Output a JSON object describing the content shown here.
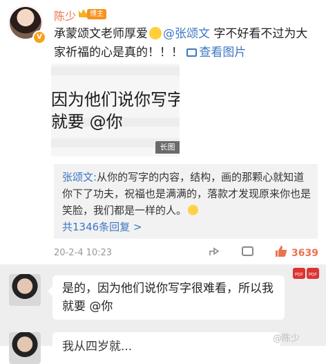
{
  "post": {
    "username": "陈少",
    "badge": "博主",
    "avatar_badge": "V",
    "text_before": "承蒙颂文老师厚爱",
    "mention": "@张颂文",
    "text_after": " 字不好看不过为大家祈福的心是真的！！！",
    "image_link": "查看图片"
  },
  "preview": {
    "line1": "因为他们说你写字很",
    "line2": "就要 @你",
    "line3": "",
    "badge": "长图"
  },
  "reply": {
    "author": "张颂文:",
    "text": "从你的写字的内容，结构，画的那颗心就知道你下了功夫，祝福也是满满的，落款才发现原来你也是笑脸，我们都是一样的人。",
    "count_label": "共1346条回复 >"
  },
  "footer": {
    "timestamp": "20-2-4 10:23",
    "like_count": "3639"
  },
  "chat": {
    "bubble_text": "是的，因为他们说你写字很难看，所以我就要 @你",
    "bubble2_text": "我从四岁就...",
    "pdf_label": "PDF"
  },
  "watermark": "@陈少"
}
